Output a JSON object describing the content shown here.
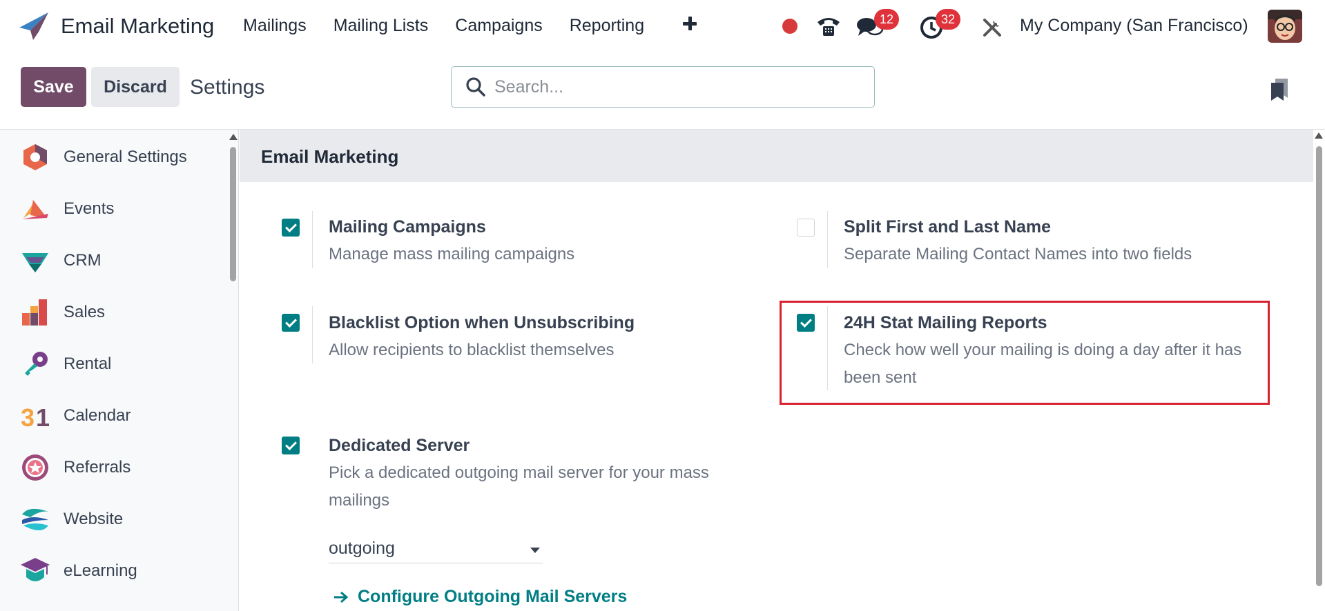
{
  "navbar": {
    "app_title": "Email Marketing",
    "menu": [
      "Mailings",
      "Mailing Lists",
      "Campaigns",
      "Reporting"
    ],
    "chat_badge": "12",
    "activity_badge": "32",
    "company": "My Company (San Francisco)"
  },
  "control": {
    "save_label": "Save",
    "discard_label": "Discard",
    "breadcrumb": "Settings",
    "search_placeholder": "Search..."
  },
  "sidebar": {
    "items": [
      {
        "label": "General Settings",
        "icon": "general-settings-icon"
      },
      {
        "label": "Events",
        "icon": "events-icon"
      },
      {
        "label": "CRM",
        "icon": "crm-icon"
      },
      {
        "label": "Sales",
        "icon": "sales-icon"
      },
      {
        "label": "Rental",
        "icon": "rental-icon"
      },
      {
        "label": "Calendar",
        "icon": "calendar-icon"
      },
      {
        "label": "Referrals",
        "icon": "referrals-icon"
      },
      {
        "label": "Website",
        "icon": "website-icon"
      },
      {
        "label": "eLearning",
        "icon": "elearning-icon"
      }
    ]
  },
  "section": {
    "title": "Email Marketing",
    "settings": [
      {
        "title": "Mailing Campaigns",
        "description": "Manage mass mailing campaigns",
        "checked": true
      },
      {
        "title": "Split First and Last Name",
        "description": "Separate Mailing Contact Names into two fields",
        "checked": false
      },
      {
        "title": "Blacklist Option when Unsubscribing",
        "description": "Allow recipients to blacklist themselves",
        "checked": true
      },
      {
        "title": "24H Stat Mailing Reports",
        "description": "Check how well your mailing is doing a day after it has been sent",
        "checked": true
      },
      {
        "title": "Dedicated Server",
        "description": "Pick a dedicated outgoing mail server for your mass mailings",
        "checked": true
      }
    ],
    "server_select_value": "outgoing",
    "configure_link": "Configure Outgoing Mail Servers"
  },
  "colors": {
    "brand": "#714b67",
    "accent": "#017e84",
    "badge": "#e0323a",
    "highlight": "#d9202e"
  }
}
